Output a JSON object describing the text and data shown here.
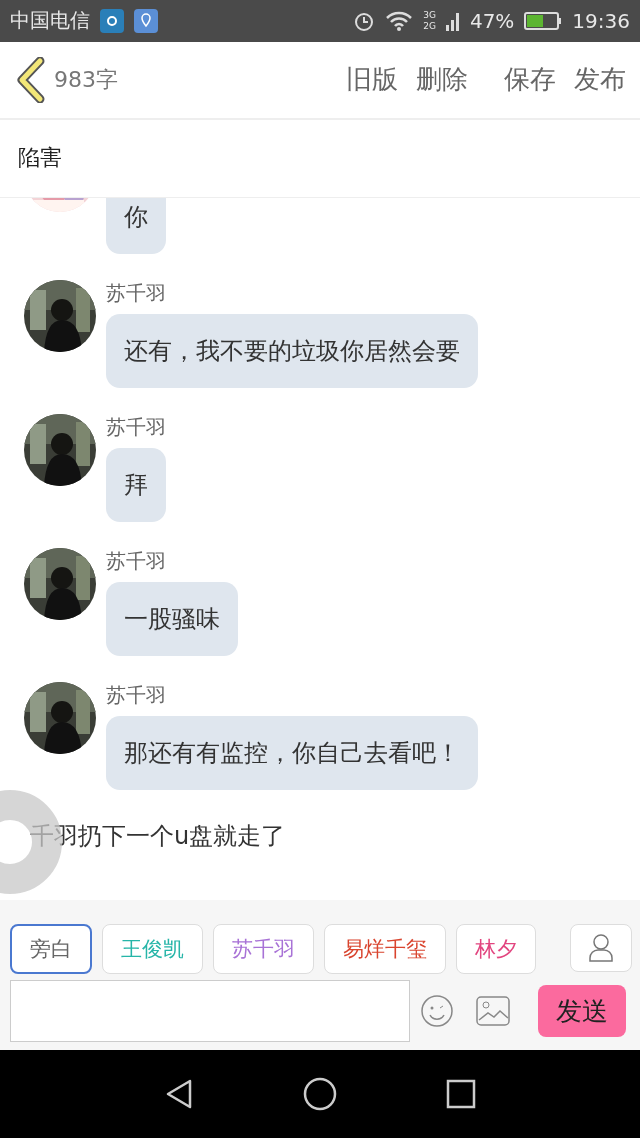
{
  "status_bar": {
    "carrier": "中国电信",
    "battery": "47%",
    "time": "19:36",
    "network": [
      "3G",
      "2G"
    ]
  },
  "header": {
    "word_count": "983字",
    "actions": [
      "旧版",
      "删除",
      "保存",
      "发布"
    ]
  },
  "title": "陷害",
  "messages": [
    {
      "kind": "dialogue",
      "text": "你"
    },
    {
      "kind": "dialogue",
      "speaker": "苏千羽",
      "text": "还有，我不要的垃圾你居然会要"
    },
    {
      "kind": "dialogue",
      "speaker": "苏千羽",
      "text": "拜"
    },
    {
      "kind": "dialogue",
      "speaker": "苏千羽",
      "text": "一股骚味"
    },
    {
      "kind": "dialogue",
      "speaker": "苏千羽",
      "text": "那还有有监控，你自己去看吧！"
    },
    {
      "kind": "narration",
      "text": "千羽扔下一个u盘就走了"
    }
  ],
  "roles": [
    {
      "name": "旁白",
      "color": "#666666",
      "selected": true
    },
    {
      "name": "王俊凯",
      "color": "#26b5a8",
      "selected": false
    },
    {
      "name": "苏千羽",
      "color": "#a872d6",
      "selected": false
    },
    {
      "name": "易烊千玺",
      "color": "#d9442e",
      "selected": false
    },
    {
      "name": "林夕",
      "color": "#e2457f",
      "selected": false
    }
  ],
  "composer": {
    "send": "发送"
  }
}
